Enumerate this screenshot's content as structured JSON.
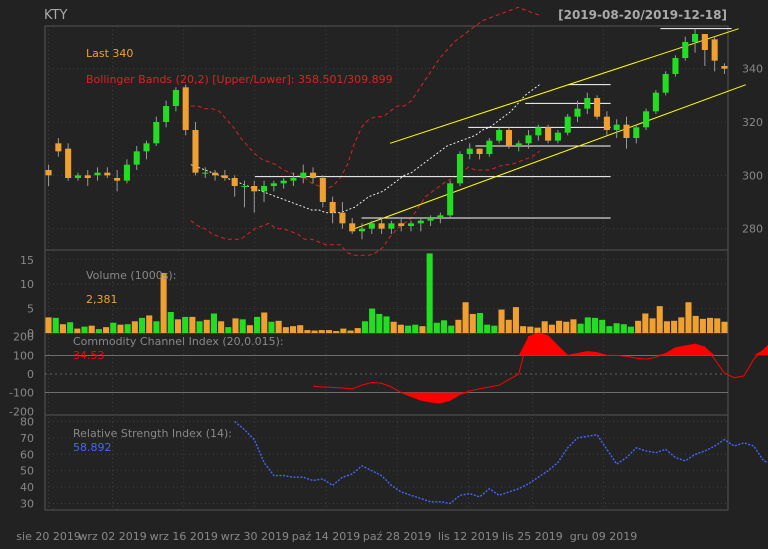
{
  "header": {
    "symbol": "KTY",
    "range": "[2019-08-20/2019-12-18]"
  },
  "colors": {
    "bg": "#222222",
    "plot_bg": "#232323",
    "grid": "#444444",
    "border": "#555555",
    "up": "#22dd22",
    "down": "#f0a030",
    "text": "#888888",
    "title": "#aaaaaa",
    "last": "#f0a030",
    "bbands": "#dd2222",
    "sma": "#ffffff",
    "trend": "#ffff00",
    "cci": "#ff0000",
    "rsi": "#4466ff"
  },
  "chart_data": [
    {
      "type": "candlestick",
      "panel": "price",
      "last_label": "Last 340",
      "bbands_label": "Bollinger Bands (20,2) [Upper/Lower]: 358.501/309.899",
      "ylim": [
        272,
        356
      ],
      "yticks": [
        280,
        300,
        320,
        340
      ],
      "x_labels": [
        "sie 20 2019",
        "wrz 02 2019",
        "wrz 16 2019",
        "wrz 30 2019",
        "paź 14 2019",
        "paź 28 2019",
        "lis 12 2019",
        "lis 25 2019",
        "gru 09 2019"
      ],
      "x_label_index": [
        0,
        9,
        19,
        29,
        39,
        49,
        59,
        68,
        78
      ],
      "ohlc": [
        [
          302,
          304,
          296,
          300
        ],
        [
          312,
          314,
          307,
          309
        ],
        [
          310,
          312,
          298,
          299
        ],
        [
          299,
          301,
          298,
          300
        ],
        [
          300,
          302,
          296,
          299
        ],
        [
          300,
          303,
          298,
          301
        ],
        [
          301,
          303,
          299,
          300
        ],
        [
          299,
          302,
          294,
          298
        ],
        [
          298,
          306,
          297,
          304
        ],
        [
          304,
          311,
          302,
          309
        ],
        [
          309,
          313,
          306,
          312
        ],
        [
          312,
          322,
          311,
          320
        ],
        [
          320,
          328,
          318,
          326
        ],
        [
          326,
          333,
          324,
          332
        ],
        [
          333,
          334,
          315,
          317
        ],
        [
          317,
          320,
          300,
          301
        ],
        [
          301,
          303,
          299,
          301
        ],
        [
          301,
          302,
          298,
          300
        ],
        [
          300,
          302,
          298,
          299
        ],
        [
          299,
          300,
          292,
          296
        ],
        [
          296,
          298,
          288,
          296
        ],
        [
          296,
          298,
          286,
          294
        ],
        [
          294,
          298,
          290,
          296
        ],
        [
          296,
          298,
          294,
          297
        ],
        [
          297,
          299,
          295,
          298
        ],
        [
          298,
          301,
          296,
          299
        ],
        [
          299,
          304,
          297,
          301
        ],
        [
          301,
          303,
          297,
          299
        ],
        [
          299,
          300,
          288,
          290
        ],
        [
          290,
          292,
          282,
          286
        ],
        [
          286,
          290,
          280,
          282
        ],
        [
          282,
          284,
          278,
          279
        ],
        [
          279,
          282,
          276,
          280
        ],
        [
          280,
          283,
          278,
          282
        ],
        [
          282,
          284,
          278,
          280
        ],
        [
          280,
          283,
          278,
          282
        ],
        [
          282,
          284,
          279,
          281
        ],
        [
          281,
          283,
          279,
          282
        ],
        [
          282,
          284,
          279,
          283
        ],
        [
          283,
          285,
          281,
          284
        ],
        [
          284,
          286,
          282,
          285
        ],
        [
          285,
          298,
          284,
          297
        ],
        [
          297,
          309,
          296,
          308
        ],
        [
          308,
          312,
          306,
          310
        ],
        [
          310,
          310,
          306,
          308
        ],
        [
          308,
          314,
          307,
          313
        ],
        [
          313,
          318,
          312,
          317
        ],
        [
          317,
          318,
          310,
          311
        ],
        [
          311,
          313,
          309,
          312
        ],
        [
          312,
          317,
          310,
          315
        ],
        [
          315,
          319,
          313,
          318
        ],
        [
          318,
          319,
          312,
          313
        ],
        [
          313,
          317,
          312,
          316
        ],
        [
          316,
          323,
          315,
          322
        ],
        [
          322,
          328,
          320,
          325
        ],
        [
          325,
          331,
          323,
          329
        ],
        [
          329,
          330,
          321,
          322
        ],
        [
          322,
          324,
          315,
          317
        ],
        [
          317,
          321,
          314,
          319
        ],
        [
          319,
          322,
          310,
          314
        ],
        [
          314,
          319,
          312,
          318
        ],
        [
          318,
          325,
          317,
          324
        ],
        [
          324,
          332,
          323,
          331
        ],
        [
          331,
          339,
          330,
          338
        ],
        [
          338,
          345,
          337,
          344
        ],
        [
          344,
          352,
          343,
          350
        ],
        [
          350,
          355,
          346,
          353
        ],
        [
          353,
          352,
          341,
          347
        ],
        [
          351,
          352,
          339,
          343
        ],
        [
          341,
          342,
          338,
          340
        ]
      ],
      "sma20": [
        null,
        null,
        null,
        null,
        null,
        null,
        null,
        null,
        null,
        null,
        null,
        null,
        null,
        null,
        null,
        null,
        null,
        null,
        null,
        null,
        304,
        303,
        302,
        301,
        300,
        299,
        298,
        297,
        296,
        295,
        294,
        293,
        292,
        291,
        290,
        289,
        288,
        287,
        287,
        286,
        286,
        286,
        287,
        288,
        290,
        292,
        293,
        294,
        296,
        298,
        300,
        301,
        303,
        305,
        307,
        309,
        311,
        312,
        313,
        314,
        315,
        317,
        318,
        320,
        322,
        324,
        327,
        330,
        332,
        334
      ],
      "bb_upper": [
        null,
        null,
        null,
        null,
        null,
        null,
        null,
        null,
        null,
        null,
        null,
        null,
        null,
        null,
        null,
        null,
        null,
        null,
        null,
        null,
        326,
        326,
        325,
        325,
        324,
        321,
        318,
        314,
        311,
        308,
        306,
        305,
        304,
        302,
        301,
        300,
        299,
        297,
        296,
        295,
        296,
        299,
        304,
        312,
        318,
        321,
        322,
        322,
        324,
        326,
        326,
        328,
        332,
        336,
        340,
        344,
        347,
        350,
        352,
        354,
        356,
        358,
        359,
        360,
        361,
        362,
        363,
        362,
        361,
        360
      ],
      "bb_lower": [
        null,
        null,
        null,
        null,
        null,
        null,
        null,
        null,
        null,
        null,
        null,
        null,
        null,
        null,
        null,
        null,
        null,
        null,
        null,
        null,
        283,
        281,
        280,
        278,
        277,
        276,
        276,
        276,
        278,
        280,
        281,
        282,
        280,
        280,
        279,
        278,
        276,
        276,
        275,
        274,
        274,
        274,
        271,
        270,
        270,
        270,
        271,
        273,
        277,
        280,
        282,
        284,
        288,
        292,
        294,
        296,
        298,
        299,
        301,
        303,
        302,
        302,
        302,
        303,
        304,
        304,
        305,
        306,
        307,
        309
      ],
      "hlines": [
        {
          "y": 299.5,
          "from": 29,
          "to": 79
        },
        {
          "y": 284,
          "from": 44,
          "to": 79
        },
        {
          "y": 311,
          "from": 60,
          "to": 79
        },
        {
          "y": 318,
          "from": 59,
          "to": 79
        },
        {
          "y": 327,
          "from": 67,
          "to": 79
        },
        {
          "y": 334,
          "from": 73,
          "to": 79
        },
        {
          "y": 355,
          "from": 86,
          "to": 96
        }
      ],
      "trend_lines": [
        [
          [
            48,
            312
          ],
          [
            97,
            355
          ]
        ],
        [
          [
            43,
            280
          ],
          [
            98,
            334
          ]
        ]
      ]
    },
    {
      "type": "bar",
      "panel": "volume",
      "label": "Volume (1000s):",
      "last": "2,381",
      "ylim": [
        0,
        17
      ],
      "yticks": [
        0,
        5,
        10,
        15
      ],
      "values": [
        3.2,
        3.1,
        1.8,
        2.2,
        0.9,
        1.3,
        1.5,
        0.8,
        1.2,
        2.1,
        1.7,
        1.8,
        2.4,
        3.1,
        3.6,
        2.4,
        12.3,
        4.3,
        2.8,
        3.3,
        3.3,
        2.4,
        2.7,
        4.0,
        2.4,
        1.2,
        3.0,
        2.8,
        1.6,
        3.3,
        4.2,
        2.3,
        2.5,
        1.2,
        1.4,
        1.6,
        0.6,
        0.5,
        0.6,
        0.6,
        0.4,
        0.9,
        0.5,
        1.0,
        2.4,
        5.0,
        3.9,
        3.4,
        2.3,
        1.7,
        1.5,
        1.7,
        1.4,
        16.3,
        2.1,
        2.6,
        1.5,
        2.7,
        6.3,
        3.9,
        4.1,
        1.7,
        1.5,
        4.8,
        2.7,
        5.3,
        1.4,
        1.3,
        1.1,
        2.4,
        1.7,
        2.5,
        2.3,
        2.8,
        1.9,
        3.2,
        3.1,
        2.7,
        1.4,
        2.0,
        1.8,
        1.3,
        2.5,
        4.0,
        3.0,
        5.5,
        2.4,
        2.5,
        3.2,
        6.3,
        3.5,
        2.9,
        3.1,
        3.0,
        2.3
      ],
      "up_mask": "0101010101010101010101010101010100000000000011110011011110001110000000000011111111000000000"
    },
    {
      "type": "area",
      "panel": "cci",
      "label": "Commodity Channel Index (20,0.015):",
      "last": "34.53",
      "ylim": [
        -220,
        220
      ],
      "yticks": [
        200,
        100,
        0,
        -100,
        -200
      ],
      "hlines": [
        100,
        0,
        -100
      ],
      "start_index": 27,
      "values": [
        -65,
        -70,
        -72,
        -75,
        -80,
        -60,
        -45,
        -50,
        -70,
        -100,
        -120,
        -140,
        -150,
        -155,
        -140,
        -110,
        -90,
        -80,
        -70,
        -60,
        -30,
        0,
        200,
        220,
        205,
        150,
        100,
        110,
        120,
        115,
        100,
        100,
        95,
        85,
        80,
        90,
        110,
        140,
        150,
        160,
        145,
        80,
        5,
        -20,
        -10,
        80,
        130,
        180,
        200,
        190,
        170,
        160,
        170,
        160,
        140,
        120,
        90,
        70,
        55,
        40
      ]
    },
    {
      "type": "line",
      "panel": "rsi",
      "label": "Relative Strength Index (14):",
      "last": "58.892",
      "ylim": [
        26,
        84
      ],
      "yticks": [
        80,
        70,
        60,
        50,
        40,
        30
      ],
      "start_index": 19,
      "values": [
        80,
        75,
        69,
        55,
        47,
        47,
        46,
        46,
        44,
        45,
        41,
        46,
        48,
        53,
        50,
        47,
        41,
        37,
        35,
        33,
        31,
        31,
        30,
        35,
        36,
        34,
        39,
        35,
        37,
        39,
        42,
        46,
        50,
        55,
        64,
        70,
        71,
        72,
        63,
        54,
        58,
        64,
        62,
        61,
        63,
        58,
        56,
        60,
        62,
        65,
        69,
        65,
        67,
        65,
        56,
        54,
        60,
        53,
        54,
        55,
        64,
        66,
        68,
        70,
        70,
        71,
        73,
        74,
        76,
        75,
        72,
        72,
        69,
        58,
        58
      ]
    }
  ]
}
